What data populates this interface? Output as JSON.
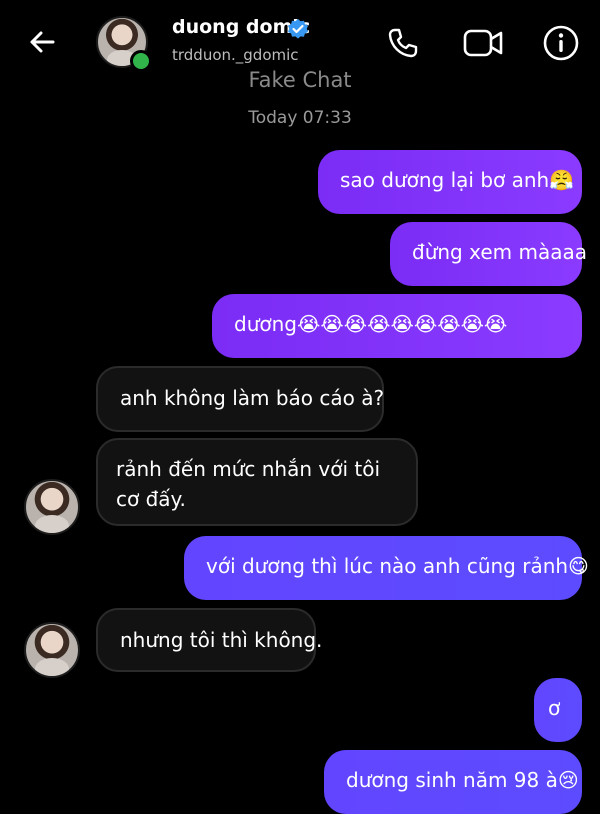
{
  "header": {
    "contact_name": "duong domic",
    "username": "trdduon._gdomic",
    "verified": true,
    "online": true,
    "icons": [
      "back-arrow-icon",
      "phone-icon",
      "video-camera-icon",
      "info-icon"
    ]
  },
  "watermark": "Fake Chat",
  "timestamp": "Today 07:33",
  "messages": [
    {
      "direction": "outgoing",
      "text": "sao dương lại bơ anh😤"
    },
    {
      "direction": "outgoing",
      "text": "đừng xem màaaa"
    },
    {
      "direction": "outgoing",
      "text": "dương😭😭😭😭😭😭😭😭😭"
    },
    {
      "direction": "incoming",
      "text": "anh không làm báo cáo à?"
    },
    {
      "direction": "incoming",
      "text": "rảnh đến mức nhắn với tôi cơ đấy."
    },
    {
      "direction": "outgoing",
      "text": "với dương thì lúc nào anh cũng rảnh😋"
    },
    {
      "direction": "incoming",
      "text": "nhưng tôi thì không."
    },
    {
      "direction": "outgoing",
      "text": "ơ"
    },
    {
      "direction": "outgoing",
      "text": "dương sinh năm 98 à😢"
    }
  ],
  "colors": {
    "background": "#000000",
    "outgoing_bubble": "#7b2cf5",
    "outgoing_bubble_alt": "#5d4bff",
    "incoming_bubble": "#121212",
    "online": "#31b54a",
    "verified": "#3897f0"
  }
}
